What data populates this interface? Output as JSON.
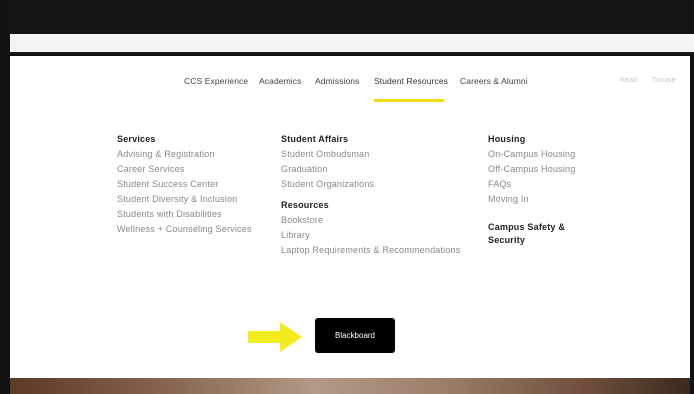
{
  "nav": {
    "items": [
      "CCS Experience",
      "Academics",
      "Admissions",
      "Student Resources",
      "Careers & Alumni"
    ],
    "active": "Student Resources",
    "faint": [
      "Read",
      "Donate"
    ]
  },
  "columns": [
    {
      "sections": [
        {
          "heading": "Services",
          "links": [
            "Advising & Registration",
            "Career Services",
            "Student Success Center",
            "Student Diversity & Inclusion",
            "Students with Disabilities",
            "Wellness + Counseling Services"
          ]
        }
      ]
    },
    {
      "sections": [
        {
          "heading": "Student Affairs",
          "links": [
            "Student Ombudsman",
            "Graduation",
            "Student Organizations"
          ]
        },
        {
          "heading": "Resources",
          "links": [
            "Bookstore",
            "Library",
            "Laptop Requirements & Recommendations"
          ]
        }
      ]
    },
    {
      "sections": [
        {
          "heading": "Housing",
          "links": [
            "On-Campus Housing",
            "Off-Campus Housing",
            "FAQs",
            "Moving In"
          ]
        },
        {
          "heading_lines": [
            "Campus Safety &",
            "Security"
          ]
        }
      ]
    }
  ],
  "blackboard_label": "Blackboard",
  "colors": {
    "accent": "#f5dd1a",
    "arrow": "#f2ec1e",
    "button_bg": "#000000"
  },
  "icons": {
    "arrow": "arrow-right-icon"
  }
}
